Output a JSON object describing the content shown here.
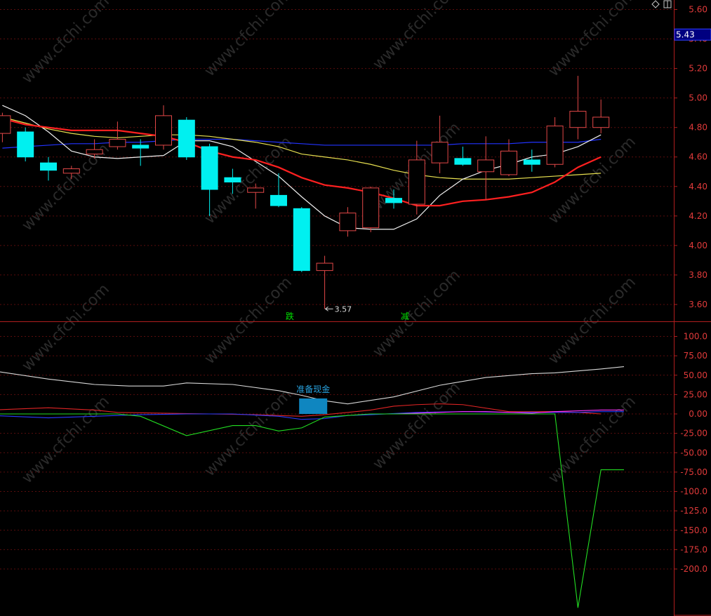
{
  "toolbar": {
    "diamond_icon": "diamond-icon",
    "panel_icon": "panel-toggle-icon"
  },
  "watermark": "www.cfchi.com",
  "colors": {
    "background": "#000000",
    "grid": "#5a0d0d",
    "axis": "#b01e1e",
    "axis_text": "#e03a3a",
    "up": "#e34848",
    "down": "#00f0f0",
    "ma_white": "#f0f0f0",
    "ma_red": "#ff2020",
    "ma_yellow": "#e8e050",
    "ma_blue": "#2233ff",
    "osc_white": "#d8d8d8",
    "osc_red": "#e02424",
    "osc_blue": "#2a3cff",
    "osc_magenta": "#ff30ff",
    "osc_green": "#22dd22",
    "cash_box": "#0f86c0"
  },
  "chart_data": [
    {
      "type": "candlestick",
      "price_tag": "5.43",
      "ylim": [
        3.5,
        5.65
      ],
      "yticks": [
        "5.60",
        "5.40",
        "5.20",
        "5.00",
        "4.80",
        "4.60",
        "4.40",
        "4.20",
        "4.00",
        "3.80",
        "3.60"
      ],
      "min_label": "3.57",
      "signals": [
        "跌",
        "减"
      ],
      "candles": [
        {
          "o": 4.76,
          "h": 4.9,
          "l": 4.7,
          "c": 4.88
        },
        {
          "o": 4.77,
          "h": 4.8,
          "l": 4.57,
          "c": 4.6
        },
        {
          "o": 4.56,
          "h": 4.6,
          "l": 4.44,
          "c": 4.51
        },
        {
          "o": 4.49,
          "h": 4.54,
          "l": 4.45,
          "c": 4.52
        },
        {
          "o": 4.62,
          "h": 4.72,
          "l": 4.59,
          "c": 4.65
        },
        {
          "o": 4.67,
          "h": 4.84,
          "l": 4.65,
          "c": 4.72
        },
        {
          "o": 4.68,
          "h": 4.72,
          "l": 4.54,
          "c": 4.66
        },
        {
          "o": 4.68,
          "h": 4.95,
          "l": 4.65,
          "c": 4.88
        },
        {
          "o": 4.85,
          "h": 4.87,
          "l": 4.58,
          "c": 4.6
        },
        {
          "o": 4.67,
          "h": 4.69,
          "l": 4.2,
          "c": 4.38
        },
        {
          "o": 4.46,
          "h": 4.52,
          "l": 4.35,
          "c": 4.43
        },
        {
          "o": 4.36,
          "h": 4.42,
          "l": 4.25,
          "c": 4.39
        },
        {
          "o": 4.34,
          "h": 4.49,
          "l": 4.26,
          "c": 4.27
        },
        {
          "o": 4.25,
          "h": 4.26,
          "l": 3.82,
          "c": 3.83
        },
        {
          "o": 3.83,
          "h": 3.93,
          "l": 3.57,
          "c": 3.88
        },
        {
          "o": 4.1,
          "h": 4.26,
          "l": 4.06,
          "c": 4.22
        },
        {
          "o": 4.12,
          "h": 4.4,
          "l": 4.09,
          "c": 4.39
        },
        {
          "o": 4.32,
          "h": 4.38,
          "l": 4.25,
          "c": 4.29
        },
        {
          "o": 4.28,
          "h": 4.71,
          "l": 4.21,
          "c": 4.58
        },
        {
          "o": 4.56,
          "h": 4.88,
          "l": 4.49,
          "c": 4.7
        },
        {
          "o": 4.59,
          "h": 4.67,
          "l": 4.54,
          "c": 4.55
        },
        {
          "o": 4.5,
          "h": 4.74,
          "l": 4.31,
          "c": 4.58
        },
        {
          "o": 4.48,
          "h": 4.72,
          "l": 4.47,
          "c": 4.64
        },
        {
          "o": 4.58,
          "h": 4.65,
          "l": 4.5,
          "c": 4.55
        },
        {
          "o": 4.55,
          "h": 4.87,
          "l": 4.53,
          "c": 4.81
        },
        {
          "o": 4.8,
          "h": 5.15,
          "l": 4.72,
          "c": 4.91
        },
        {
          "o": 4.8,
          "h": 4.99,
          "l": 4.76,
          "c": 4.87
        }
      ],
      "ma_white": [
        4.95,
        4.88,
        4.77,
        4.64,
        4.6,
        4.59,
        4.6,
        4.61,
        4.71,
        4.71,
        4.67,
        4.57,
        4.47,
        4.33,
        4.2,
        4.12,
        4.11,
        4.11,
        4.18,
        4.34,
        4.45,
        4.51,
        4.55,
        4.6,
        4.62,
        4.67,
        4.75
      ],
      "ma_red": [
        4.86,
        4.82,
        4.8,
        4.78,
        4.78,
        4.78,
        4.76,
        4.74,
        4.7,
        4.64,
        4.6,
        4.58,
        4.53,
        4.46,
        4.41,
        4.39,
        4.36,
        4.32,
        4.27,
        4.27,
        4.3,
        4.31,
        4.33,
        4.36,
        4.43,
        4.53,
        4.6
      ],
      "ma_yellow": [
        4.87,
        4.83,
        4.79,
        4.76,
        4.74,
        4.73,
        4.74,
        4.75,
        4.75,
        4.74,
        4.72,
        4.7,
        4.67,
        4.62,
        4.6,
        4.58,
        4.55,
        4.51,
        4.48,
        4.46,
        4.45,
        4.45,
        4.45,
        4.46,
        4.47,
        4.48,
        4.49
      ],
      "ma_blue": [
        4.66,
        4.67,
        4.68,
        4.69,
        4.69,
        4.7,
        4.7,
        4.71,
        4.72,
        4.72,
        4.72,
        4.71,
        4.7,
        4.69,
        4.68,
        4.68,
        4.68,
        4.68,
        4.68,
        4.68,
        4.69,
        4.69,
        4.69,
        4.7,
        4.7,
        4.7,
        4.72
      ]
    },
    {
      "type": "line",
      "ylim": [
        -260,
        120
      ],
      "yticks": [
        "100.0",
        "75.00",
        "50.00",
        "25.00",
        "0.00",
        "-25.00",
        "-50.00",
        "-75.00",
        "-100.0",
        "-125.0",
        "-150.0",
        "-175.0",
        "-200.0"
      ],
      "annotation": "准备现金",
      "cash_box": {
        "index": 13.5,
        "y_top": 20,
        "y_bottom": 0
      },
      "series": [
        {
          "color": "osc_white",
          "x": [
            -0.5,
            2,
            4,
            5.5,
            7,
            8,
            10,
            12,
            13,
            14,
            15,
            17,
            19,
            21,
            23,
            24,
            26,
            27
          ],
          "y": [
            56,
            45,
            38,
            36,
            36,
            40,
            38,
            30,
            24,
            17,
            13,
            22,
            37,
            47,
            52,
            53,
            58,
            61
          ]
        },
        {
          "color": "osc_red",
          "x": [
            -0.5,
            2,
            4,
            5,
            7,
            9,
            11,
            13,
            14,
            15,
            16,
            17,
            18,
            19,
            20,
            22,
            23,
            24,
            25,
            26
          ],
          "y": [
            5,
            8,
            5,
            2,
            1,
            0,
            -1,
            -3,
            -1,
            2,
            5,
            10,
            12,
            13,
            12,
            3,
            3,
            3,
            2,
            0
          ]
        },
        {
          "color": "osc_blue",
          "x": [
            -0.5,
            2,
            4,
            6,
            8,
            10,
            12,
            13,
            14,
            15,
            16,
            18,
            20,
            22,
            24,
            25,
            26,
            27
          ],
          "y": [
            -2,
            -5,
            -3,
            -1,
            0,
            0,
            -3,
            -7,
            -6,
            -2,
            -1,
            2,
            3,
            2,
            2,
            2,
            3,
            3
          ]
        },
        {
          "color": "osc_magenta",
          "x": [
            17,
            18,
            19,
            20,
            21,
            22,
            23,
            24,
            25,
            26,
            27
          ],
          "y": [
            0,
            1,
            2,
            3,
            3,
            2,
            1,
            3,
            4,
            5,
            5
          ]
        },
        {
          "color": "osc_green",
          "x": [
            -0.5,
            2,
            4,
            5,
            6,
            8,
            10,
            11,
            12,
            13,
            14,
            15,
            16,
            17,
            18,
            19,
            20,
            21,
            22,
            23,
            24,
            25,
            26,
            27
          ],
          "y": [
            0,
            0,
            0,
            0,
            -3,
            -28,
            -15,
            -15,
            -22,
            -18,
            -4,
            -2,
            0,
            0,
            0,
            0,
            0,
            0,
            0,
            0,
            0,
            -250,
            -72,
            -72
          ]
        }
      ]
    }
  ]
}
